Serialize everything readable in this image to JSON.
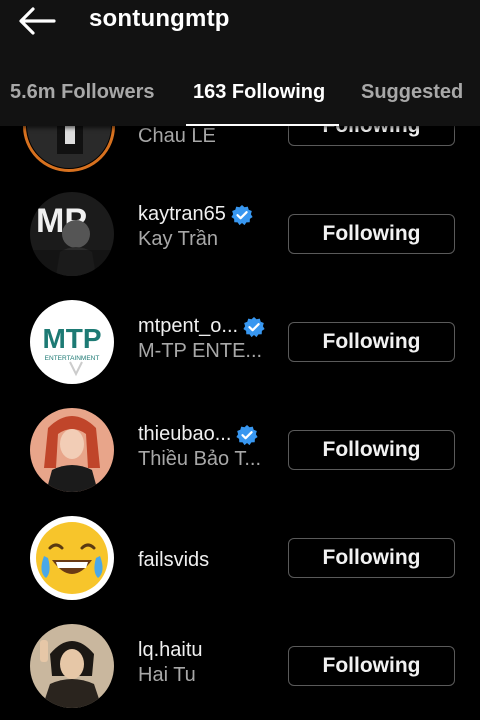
{
  "header": {
    "username": "sontungmtp",
    "back_icon": "arrow-left-icon"
  },
  "tabs": [
    {
      "label": "5.6m Followers",
      "active": false
    },
    {
      "label": "163 Following",
      "active": true
    },
    {
      "label": "Suggested",
      "active": false
    }
  ],
  "accounts": [
    {
      "handle": "",
      "name": "Chau LE",
      "verified": false,
      "button": "Following"
    },
    {
      "handle": "kaytran65",
      "name": "Kay Trần",
      "verified": true,
      "button": "Following"
    },
    {
      "handle": "mtpent_o...",
      "name": "M-TP ENTE...",
      "verified": true,
      "button": "Following"
    },
    {
      "handle": "thieubao...",
      "name": "Thiều Bảo T...",
      "verified": true,
      "button": "Following"
    },
    {
      "handle": "failsvids",
      "name": "",
      "verified": false,
      "button": "Following"
    },
    {
      "handle": "lq.haitu",
      "name": "Hai Tu",
      "verified": false,
      "button": "Following"
    }
  ],
  "mtp_logo": {
    "text": "MTP",
    "subtext": "ENTERTAINMENT"
  },
  "colors": {
    "background": "#000000",
    "header": "#121212",
    "verified": "#3897f0",
    "story_ring": "#d7711f"
  }
}
